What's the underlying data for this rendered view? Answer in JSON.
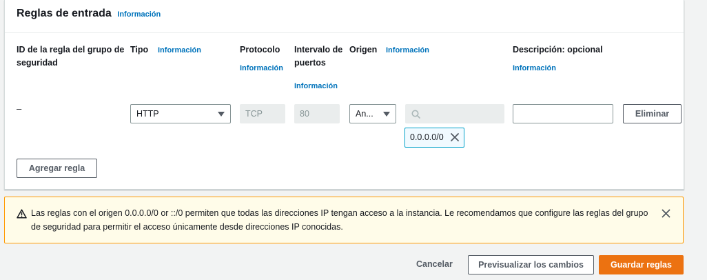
{
  "panel": {
    "title": "Reglas de entrada",
    "info": "Información"
  },
  "columns": {
    "rule_id": "ID de la regla del grupo de seguridad",
    "type": "Tipo",
    "type_info": "Información",
    "protocol": "Protocolo",
    "protocol_info": "Información",
    "port_range": "Intervalo de puertos",
    "port_info": "Información",
    "source": "Origen",
    "source_info": "Información",
    "description": "Descripción: opcional",
    "description_info": "Información"
  },
  "rule": {
    "id": "–",
    "type": "HTTP",
    "protocol": "TCP",
    "port": "80",
    "source_type": "An...",
    "source_search_value": "",
    "source_token": "0.0.0.0/0",
    "description_value": "",
    "delete_label": "Eliminar"
  },
  "add_rule_label": "Agregar regla",
  "alert": {
    "text": "Las reglas con el origen 0.0.0.0/0 or ::/0 permiten que todas las direcciones IP tengan acceso a la instancia. Le recomendamos que configure las reglas del grupo de seguridad para permitir el acceso únicamente desde direcciones IP conocidas."
  },
  "footer": {
    "cancel": "Cancelar",
    "preview": "Previsualizar los cambios",
    "save": "Guardar reglas"
  },
  "colors": {
    "link": "#0073bb",
    "primary": "#ec7211",
    "warning_border": "#ff9900",
    "warning_bg": "#fffce9",
    "token_border": "#00a1c9"
  },
  "icons": {
    "alert": "warning-triangle-icon",
    "search": "search-icon",
    "token_remove": "close-icon",
    "dismiss": "close-icon",
    "dropdown": "caret-down-icon"
  }
}
